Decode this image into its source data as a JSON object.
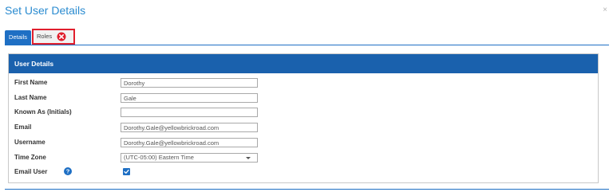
{
  "dialog": {
    "title": "Set User Details",
    "close_symbol": "×"
  },
  "tabs": [
    {
      "label": "Details",
      "active": true
    },
    {
      "label": "Roles",
      "has_error": true,
      "error_icon": "error-circle-icon"
    }
  ],
  "panel": {
    "title": "User Details"
  },
  "form": {
    "first_name": {
      "label": "First Name",
      "value": "Dorothy"
    },
    "last_name": {
      "label": "Last Name",
      "value": "Gale"
    },
    "known_as": {
      "label": "Known As (Initials)",
      "value": ""
    },
    "email": {
      "label": "Email",
      "value": "Dorothy.Gale@yellowbrickroad.com"
    },
    "username": {
      "label": "Username",
      "value": "Dorothy.Gale@yellowbrickroad.com"
    },
    "time_zone": {
      "label": "Time Zone",
      "selected": "(UTC-05:00) Eastern Time"
    },
    "email_user": {
      "label": "Email User",
      "checked": true,
      "help_icon": "question-circle-icon"
    }
  },
  "colors": {
    "accent": "#1e6fc4",
    "header": "#1a61ad",
    "title": "#2a8bd0",
    "error": "#e01f2d"
  }
}
